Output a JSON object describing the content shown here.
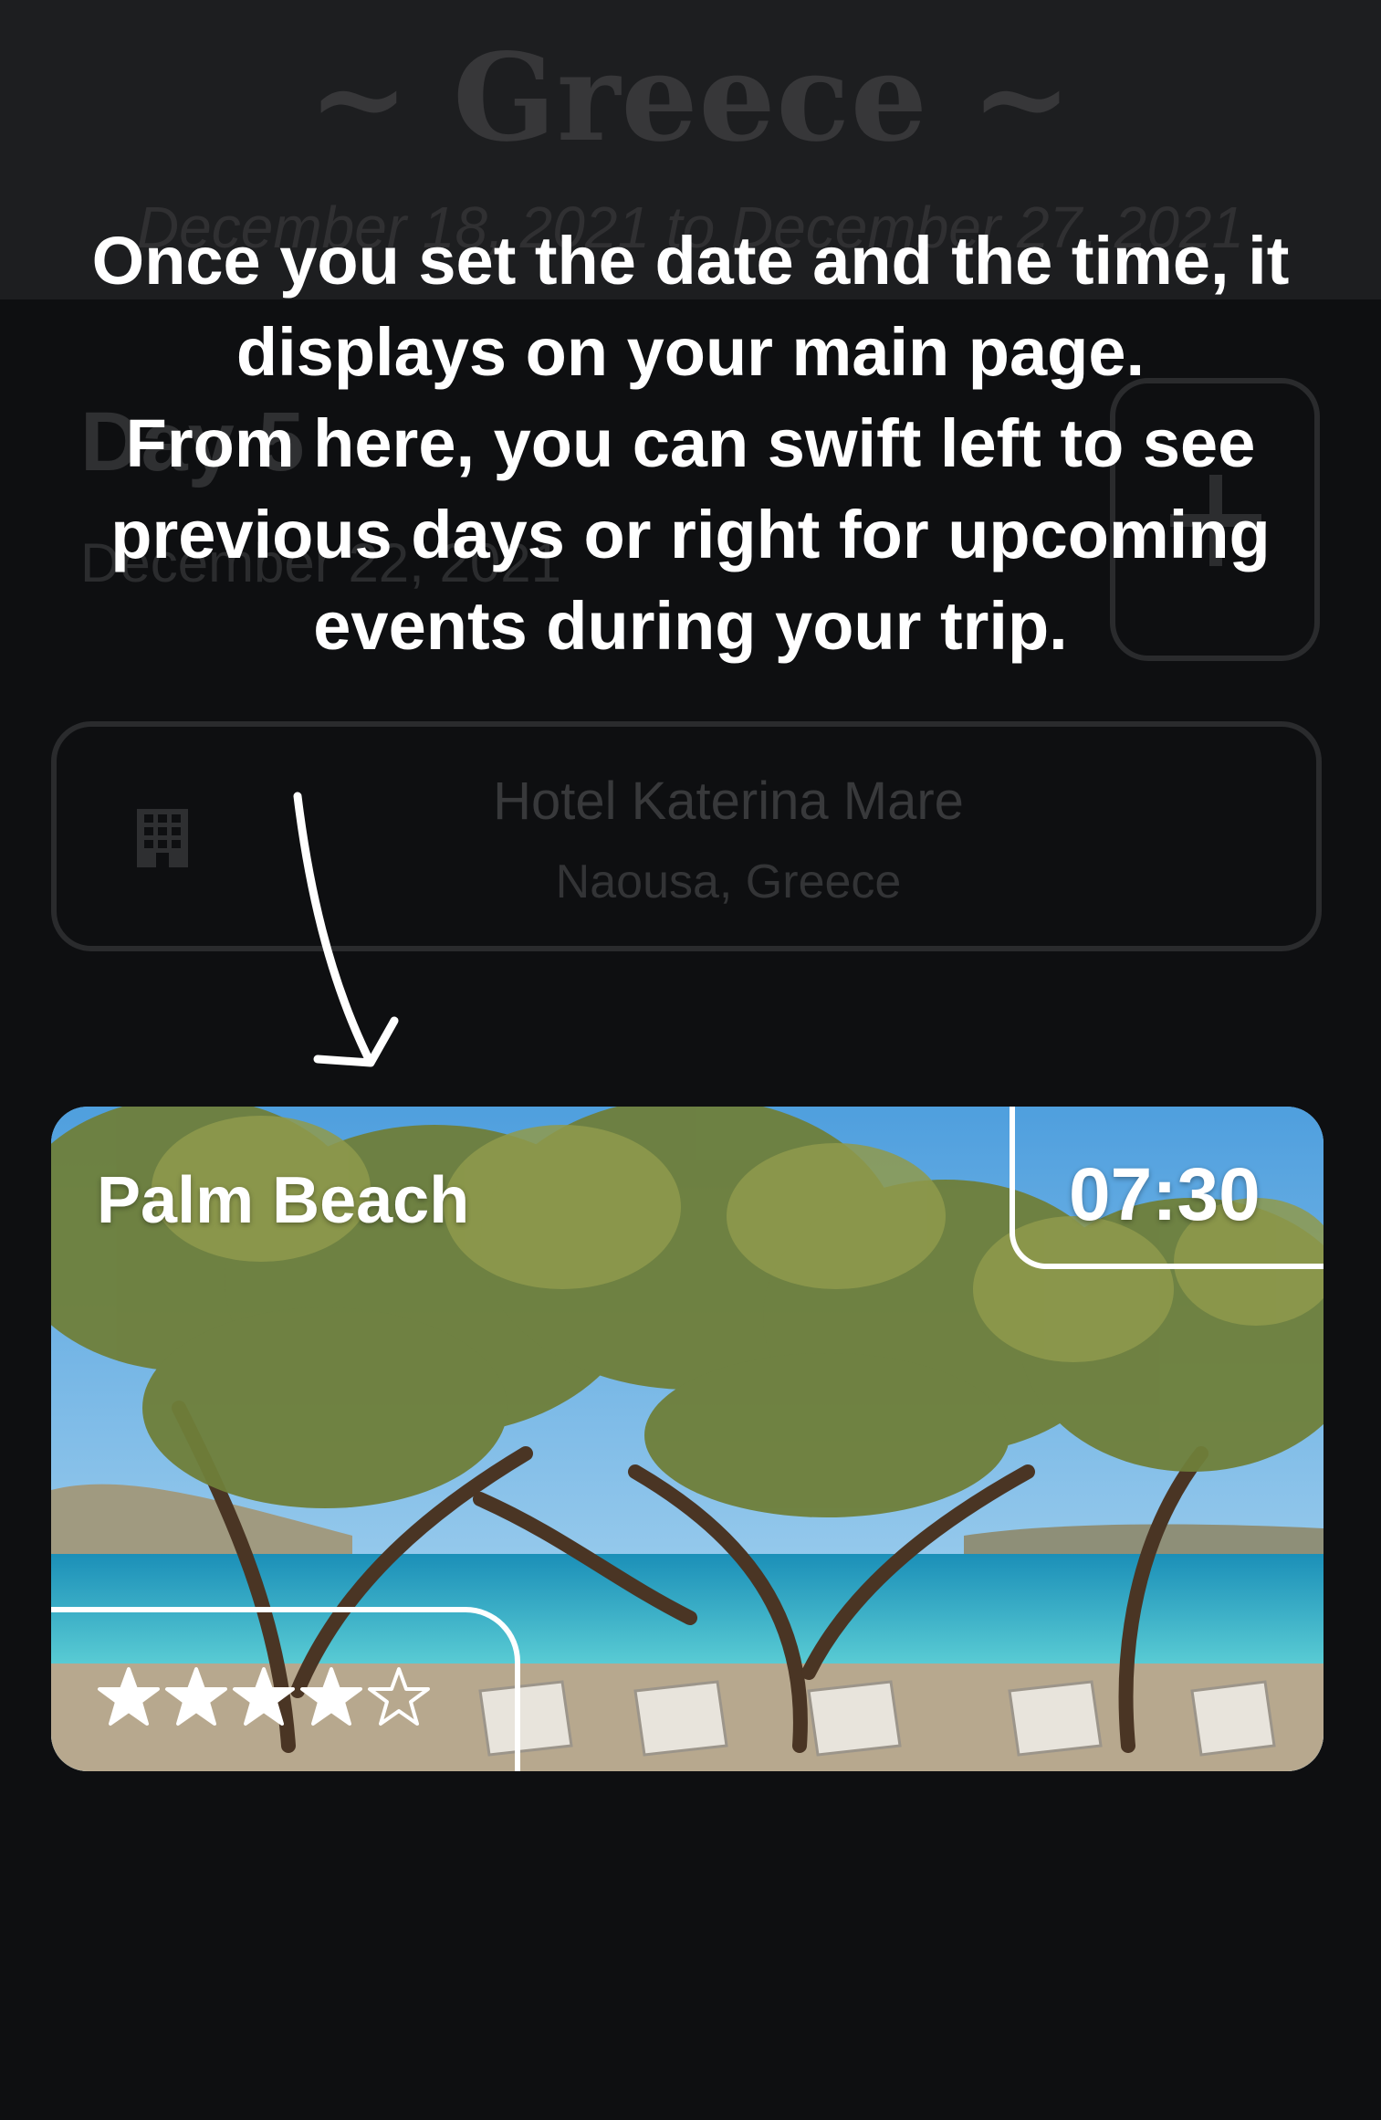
{
  "header": {
    "trip_title": "~ Greece ~",
    "trip_dates": "December 18, 2021 to December 27, 2021"
  },
  "day": {
    "label": "Day 5",
    "date": "December 22, 2021"
  },
  "add_button": {
    "icon": "plus-icon"
  },
  "hotel": {
    "icon": "building-icon",
    "name": "Hotel Katerina Mare",
    "location": "Naousa, Greece"
  },
  "overlay": {
    "line1": "Once you set the date and the time, it displays on your main page.",
    "line2": "From here, you can swift left to see previous days or right for upcoming events during your trip.",
    "arrow_icon": "arrow-down-icon"
  },
  "event": {
    "title": "Palm Beach",
    "time": "07:30",
    "rating": 4,
    "rating_max": 5,
    "star_icon": "star-icon"
  },
  "colors": {
    "background": "#0e0f11",
    "header": "#1d1e20",
    "text_primary": "#ffffff",
    "dimmed_text": "#38393b"
  }
}
